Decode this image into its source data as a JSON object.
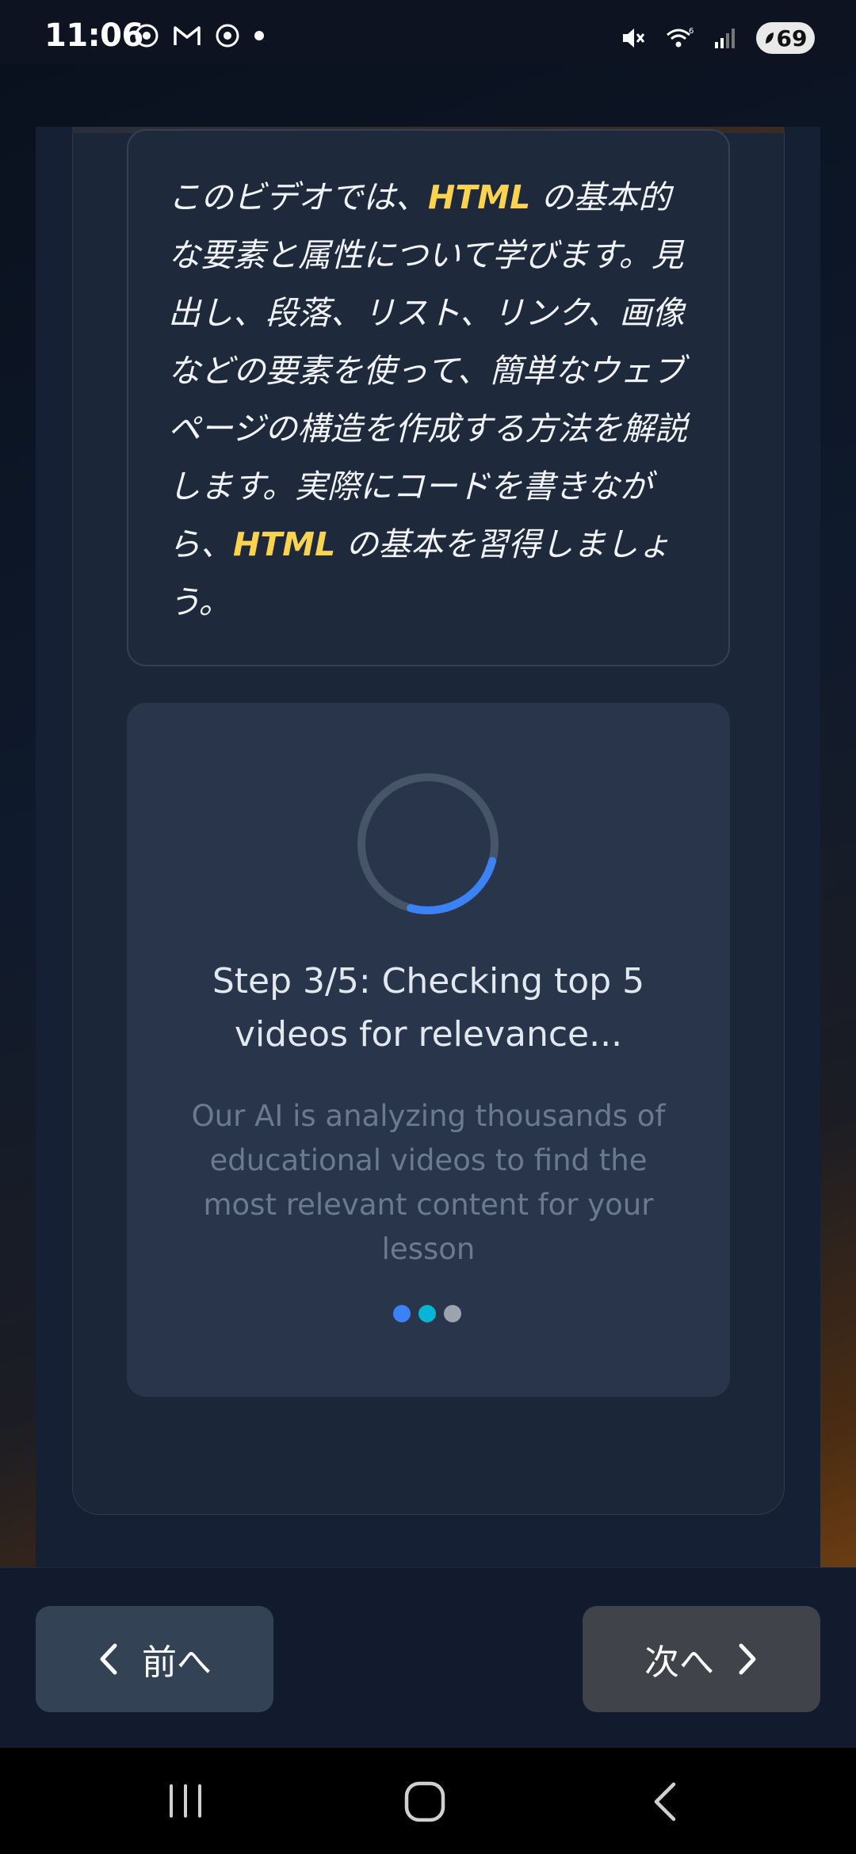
{
  "status_bar": {
    "time": "11:06",
    "battery": "69",
    "notification_icons": [
      "chrome-icon",
      "gmail-icon",
      "chrome-icon",
      "dot-icon"
    ],
    "system_icons": [
      "mute-icon",
      "wifi-6-icon",
      "signal-icon",
      "battery-icon"
    ]
  },
  "description": {
    "parts": [
      {
        "text": "このビデオでは、",
        "highlight": false
      },
      {
        "text": "HTML",
        "highlight": true
      },
      {
        "text": " の基本的な要素と属性について学びます。見出し、段落、リスト、リンク、画像などの要素を使って、簡単なウェブページの構造を作成する方法を解説します。実際にコードを書きながら、",
        "highlight": false
      },
      {
        "text": "HTML",
        "highlight": true
      },
      {
        "text": " の基本を習得しましょう。",
        "highlight": false
      }
    ]
  },
  "loading": {
    "step_text": "Step 3/5: Checking top 5 videos for relevance...",
    "sub_text": "Our AI is analyzing thousands of educational videos to find the most relevant content for your lesson",
    "progress_fraction": 0.25,
    "dot_colors": [
      "#3b82f6",
      "#06b6d4",
      "#9ca3af"
    ]
  },
  "nav": {
    "prev_label": "前へ",
    "next_label": "次へ"
  },
  "colors": {
    "highlight": "#fcd34d",
    "spinner_accent": "#3b82f6",
    "spinner_track": "#475569"
  }
}
